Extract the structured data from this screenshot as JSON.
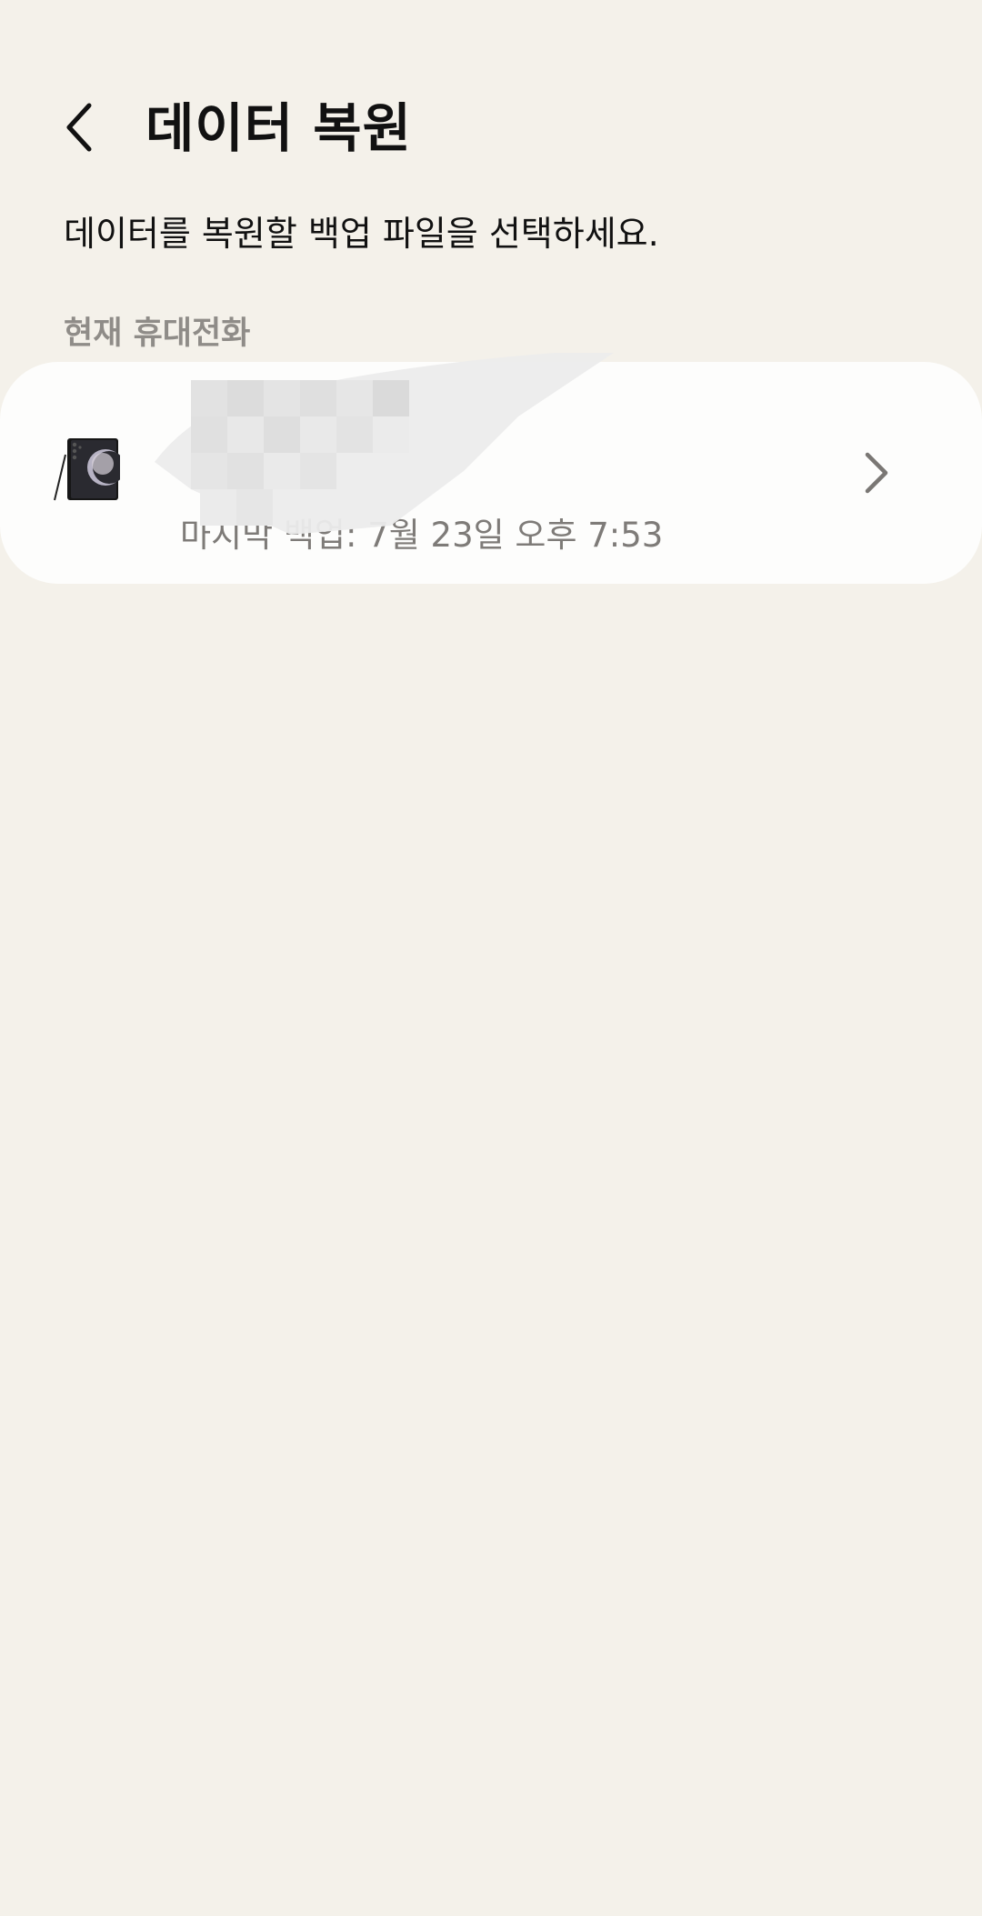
{
  "header": {
    "title": "데이터 복원",
    "back_icon": "chevron-left-icon"
  },
  "instruction": "데이터를 복원할 백업 파일을 선택하세요.",
  "section": {
    "label": "현재 휴대전화"
  },
  "device": {
    "name": "",
    "model": "",
    "backup_time": "마지막 백업: 7월 23일 오후 7:53",
    "thumb_icon": "phone-device-icon",
    "arrow_icon": "chevron-right-icon"
  },
  "colors": {
    "background": "#f4f1ea",
    "card": "#fdfdfc",
    "secondary_text": "#7e7b78",
    "section_label": "#8f8c88"
  }
}
